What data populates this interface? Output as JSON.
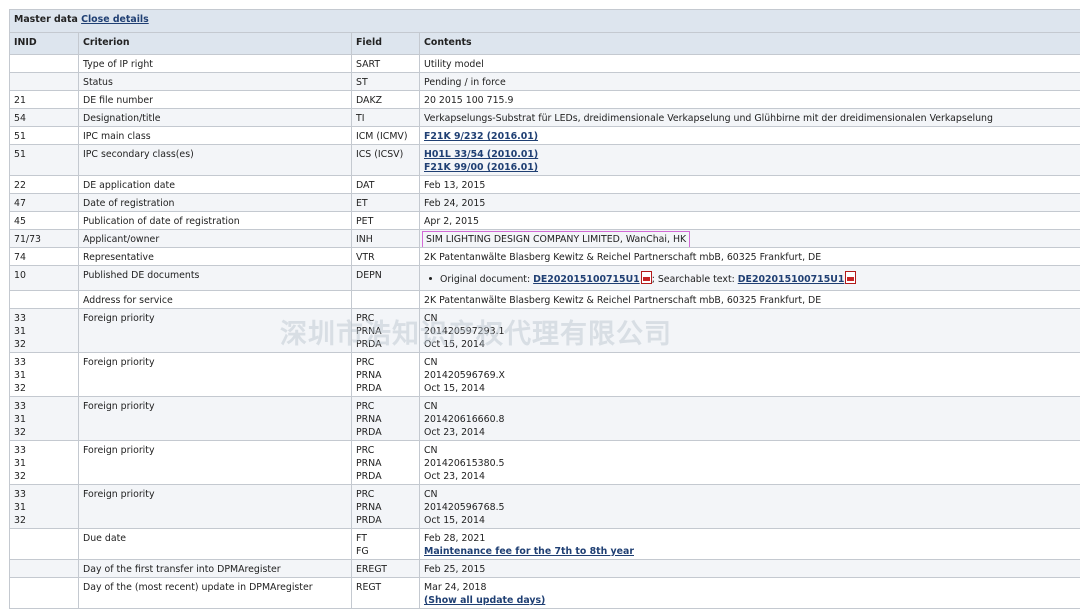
{
  "header": {
    "title": "Master data",
    "close_link": "Close details"
  },
  "columns": [
    "INID",
    "Criterion",
    "Field",
    "Contents"
  ],
  "rows": [
    {
      "inid": "",
      "criterion": "Type of IP right",
      "field": "SART",
      "contents": "Utility model"
    },
    {
      "inid": "",
      "criterion": "Status",
      "field": "ST",
      "contents": "Pending / in force"
    },
    {
      "inid": "21",
      "criterion": "DE file number",
      "field": "DAKZ",
      "contents": "20 2015 100 715.9"
    },
    {
      "inid": "54",
      "criterion": "Designation/title",
      "field": "TI",
      "contents": "Verkapselungs-Substrat für LEDs, dreidimensionale Verkapselung und Glühbirne mit der dreidimensionalen Verkapselung"
    },
    {
      "inid": "51",
      "criterion": "IPC main class",
      "field": "ICM (ICMV)",
      "link": "F21K 9/232 (2016.01)"
    },
    {
      "inid": "51",
      "criterion": "IPC secondary class(es)",
      "field": "ICS (ICSV)",
      "link1": "H01L 33/54 (2010.01)",
      "link2": "F21K 99/00 (2016.01)"
    },
    {
      "inid": "22",
      "criterion": "DE application date",
      "field": "DAT",
      "contents": "Feb 13, 2015"
    },
    {
      "inid": "47",
      "criterion": "Date of registration",
      "field": "ET",
      "contents": "Feb 24, 2015"
    },
    {
      "inid": "45",
      "criterion": "Publication of date of registration",
      "field": "PET",
      "contents": "Apr 2, 2015"
    },
    {
      "inid": "71/73",
      "criterion": "Applicant/owner",
      "field": "INH",
      "contents": "SIM LIGHTING DESIGN COMPANY LIMITED, WanChai, HK"
    },
    {
      "inid": "74",
      "criterion": "Representative",
      "field": "VTR",
      "contents": "2K Patentanwälte Blasberg Kewitz & Reichel Partnerschaft mbB, 60325 Frankfurt, DE"
    },
    {
      "inid": "10",
      "criterion": "Published DE documents",
      "field": "DEPN",
      "original_label": "Original document:",
      "original_link": "DE202015100715U1",
      "searchable_label": "; Searchable text:",
      "searchable_link": "DE202015100715U1"
    },
    {
      "inid": "",
      "criterion": "Address for service",
      "field": "",
      "contents": "2K Patentanwälte Blasberg Kewitz & Reichel Partnerschaft mbB, 60325 Frankfurt, DE"
    }
  ],
  "foreign_priorities": [
    {
      "inids": [
        "33",
        "31",
        "32"
      ],
      "criterion": "Foreign priority",
      "fields": [
        "PRC",
        "PRNA",
        "PRDA"
      ],
      "values": [
        "CN",
        "201420597293.1",
        "Oct 15, 2014"
      ]
    },
    {
      "inids": [
        "33",
        "31",
        "32"
      ],
      "criterion": "Foreign priority",
      "fields": [
        "PRC",
        "PRNA",
        "PRDA"
      ],
      "values": [
        "CN",
        "201420596769.X",
        "Oct 15, 2014"
      ]
    },
    {
      "inids": [
        "33",
        "31",
        "32"
      ],
      "criterion": "Foreign priority",
      "fields": [
        "PRC",
        "PRNA",
        "PRDA"
      ],
      "values": [
        "CN",
        "201420616660.8",
        "Oct 23, 2014"
      ]
    },
    {
      "inids": [
        "33",
        "31",
        "32"
      ],
      "criterion": "Foreign priority",
      "fields": [
        "PRC",
        "PRNA",
        "PRDA"
      ],
      "values": [
        "CN",
        "201420615380.5",
        "Oct 23, 2014"
      ]
    },
    {
      "inids": [
        "33",
        "31",
        "32"
      ],
      "criterion": "Foreign priority",
      "fields": [
        "PRC",
        "PRNA",
        "PRDA"
      ],
      "values": [
        "CN",
        "201420596768.5",
        "Oct 15, 2014"
      ]
    }
  ],
  "tail_rows": {
    "due": {
      "criterion": "Due date",
      "field1": "FT",
      "field2": "FG",
      "value1": "Feb 28, 2021",
      "link": "Maintenance fee for the 7th to 8th year"
    },
    "transfer": {
      "criterion": "Day of the first transfer into DPMAregister",
      "field": "EREGT",
      "contents": "Feb 25, 2015"
    },
    "update": {
      "criterion": "Day of the (most recent) update in DPMAregister",
      "field": "REGT",
      "contents": "Mar 24, 2018",
      "link": "(Show all update days)"
    }
  },
  "watermark": "深圳市浩知识产权代理有限公司",
  "icons": {
    "pdf": "pdf-icon"
  },
  "colors": {
    "header_bg": "#dde5ee",
    "row_alt": "#f3f5f8",
    "link": "#1f3f73",
    "border": "#c4c9d0",
    "highlight": "#d36ad6"
  }
}
